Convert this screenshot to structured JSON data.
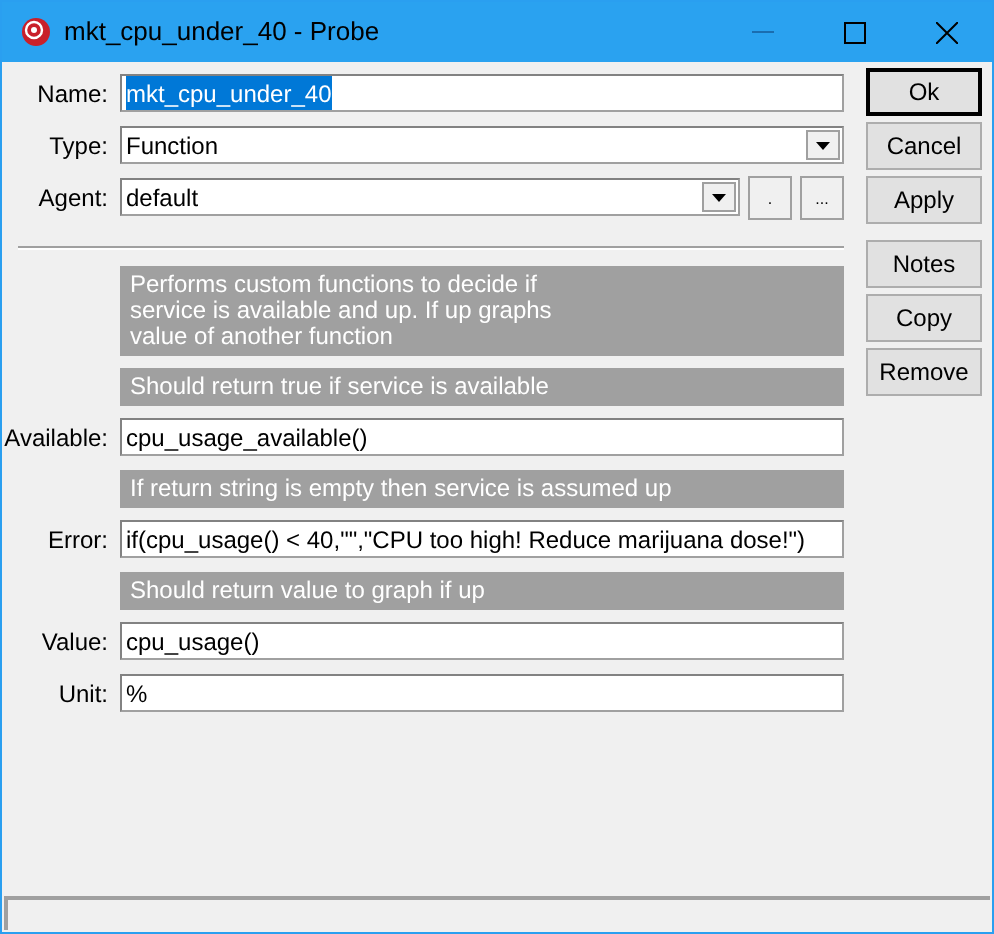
{
  "window": {
    "title": "mkt_cpu_under_40 - Probe"
  },
  "rows": [
    {
      "kind": "text",
      "label": "Name:",
      "value": "mkt_cpu_under_40",
      "text_selected": true
    },
    {
      "kind": "select",
      "label": "Type:",
      "value": "Function"
    },
    {
      "kind": "agent",
      "label": "Agent:",
      "value": "default",
      "buttons": [
        ".",
        "..."
      ]
    },
    {
      "kind": "rule"
    },
    {
      "kind": "info",
      "text": "Performs custom functions to decide if service is available and up. If up graphs value of another function"
    },
    {
      "kind": "info",
      "text": "Should return true if service is available"
    },
    {
      "kind": "text",
      "label": "Available:",
      "value": "cpu_usage_available()",
      "text_selected": false
    },
    {
      "kind": "info",
      "text": "If return string is empty then service is assumed up"
    },
    {
      "kind": "text",
      "label": "Error:",
      "value": "if(cpu_usage() < 40,\"\",\"CPU too high! Reduce marijuana dose!\")",
      "text_selected": false
    },
    {
      "kind": "info",
      "text": "Should return value to graph if up"
    },
    {
      "kind": "text",
      "label": "Value:",
      "value": "cpu_usage()",
      "text_selected": false
    },
    {
      "kind": "text",
      "label": "Unit:",
      "value": "%",
      "text_selected": false
    }
  ],
  "button_groups": [
    [
      {
        "label": "Ok",
        "default": true
      },
      {
        "label": "Cancel",
        "default": false
      },
      {
        "label": "Apply",
        "default": false
      }
    ],
    [
      {
        "label": "Notes",
        "default": false
      },
      {
        "label": "Copy",
        "default": false
      },
      {
        "label": "Remove",
        "default": false
      }
    ]
  ]
}
